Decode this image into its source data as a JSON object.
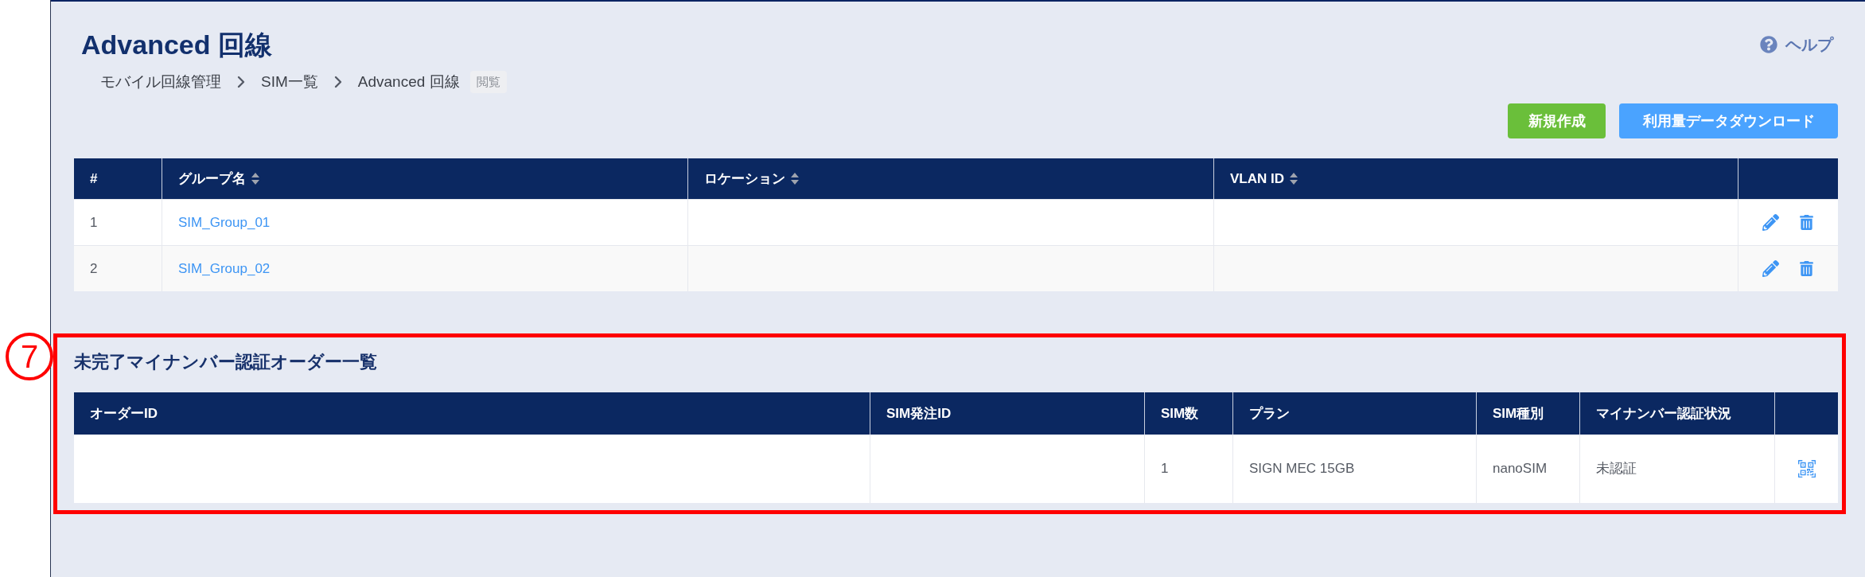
{
  "page": {
    "title": "Advanced 回線",
    "help": "ヘルプ"
  },
  "breadcrumb": {
    "items": [
      "モバイル回線管理",
      "SIM一覧",
      "Advanced 回線"
    ],
    "badge": "閲覧"
  },
  "actions": [
    {
      "label": "新規作成",
      "kind": "create"
    },
    {
      "label": "利用量データダウンロード",
      "kind": "download"
    }
  ],
  "groups_table": {
    "columns": [
      {
        "label": "#",
        "sortable": false
      },
      {
        "label": "グループ名",
        "sortable": true
      },
      {
        "label": "ロケーション",
        "sortable": true
      },
      {
        "label": "VLAN ID",
        "sortable": true
      }
    ],
    "rows": [
      {
        "number": "1",
        "group_name": "SIM_Group_01"
      },
      {
        "number": "2",
        "group_name": "SIM_Group_02"
      }
    ]
  },
  "annotation": {
    "number": "7"
  },
  "orders_section": {
    "title": "未完了マイナンバー認証オーダー一覧",
    "table": {
      "columns": [
        "オーダーID",
        "SIM発注ID",
        "SIM数",
        "プラン",
        "SIM種別",
        "マイナンバー認証状況"
      ],
      "rows": [
        {
          "sim_count": "1",
          "plan": "SIGN MEC 15GB",
          "sim_type": "nanoSIM",
          "status": "未認証"
        }
      ]
    }
  }
}
